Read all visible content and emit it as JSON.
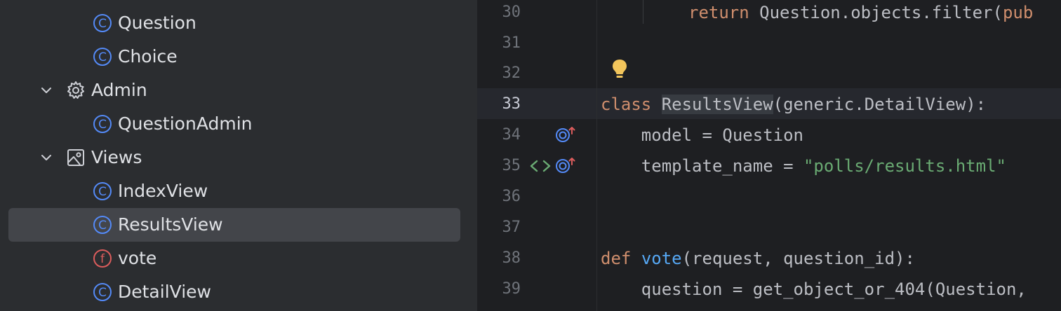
{
  "structure_panel": {
    "items": [
      {
        "label": "Question",
        "kind": "class",
        "level": 2
      },
      {
        "label": "Choice",
        "kind": "class",
        "level": 2
      },
      {
        "label": "Admin",
        "kind": "group-admin",
        "level": 1,
        "expanded": true
      },
      {
        "label": "QuestionAdmin",
        "kind": "class",
        "level": 2
      },
      {
        "label": "Views",
        "kind": "group-views",
        "level": 1,
        "expanded": true
      },
      {
        "label": "IndexView",
        "kind": "class",
        "level": 2
      },
      {
        "label": "ResultsView",
        "kind": "class",
        "level": 2,
        "selected": true
      },
      {
        "label": "vote",
        "kind": "function",
        "level": 2
      },
      {
        "label": "DetailView",
        "kind": "class",
        "level": 2
      }
    ]
  },
  "editor": {
    "current_line": "33",
    "lines": [
      {
        "num": "30",
        "code": {
          "kw1": "return",
          "rest": " Question.objects.filter(",
          "tail": "pub"
        }
      },
      {
        "num": "31"
      },
      {
        "num": "32",
        "gutter": "lightbulb-icon"
      },
      {
        "num": "33",
        "code": {
          "kw": "class",
          "space": " ",
          "name": "ResultsView",
          "rest": "(generic.DetailView):"
        }
      },
      {
        "num": "34",
        "gutter": "override-icon",
        "code": {
          "text": "    model = Question"
        }
      },
      {
        "num": "35",
        "gutter": "html-template-icon",
        "code": {
          "pre": "    template_name = ",
          "str": "\"polls/results.html\""
        }
      },
      {
        "num": "36"
      },
      {
        "num": "37"
      },
      {
        "num": "38",
        "code": {
          "kw": "def",
          "space": " ",
          "fn": "vote",
          "rest": "(request, question_id):"
        }
      },
      {
        "num": "39",
        "code": {
          "text": "    question = get_object_or_404(Question,"
        }
      }
    ]
  },
  "colors": {
    "panel_bg": "#2b2d30",
    "editor_bg": "#1e1f22",
    "selection": "#43454a",
    "class_icon": "#548af7",
    "function_icon": "#db5c5c",
    "keyword": "#cf8e6d",
    "function_name": "#56a8f5",
    "string": "#6aab73"
  }
}
